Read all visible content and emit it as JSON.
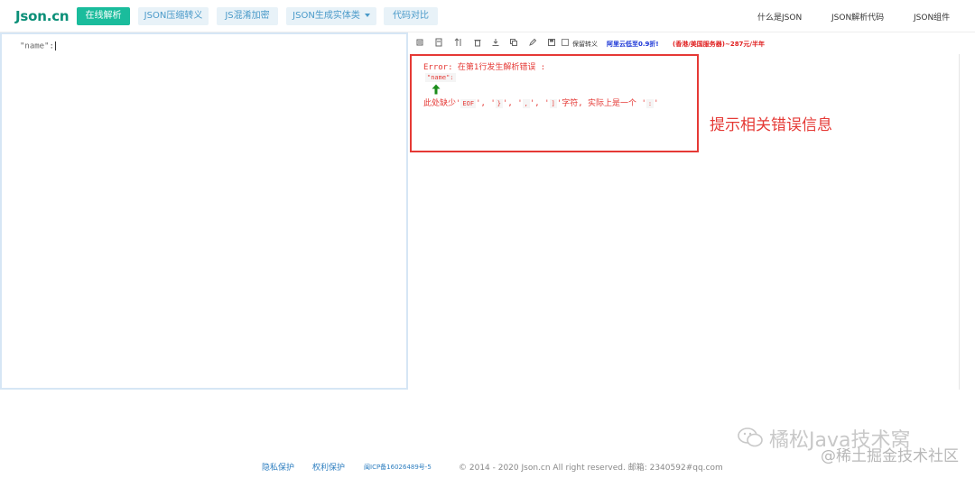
{
  "header": {
    "logo": "Json.cn",
    "nav": [
      {
        "label": "在线解析",
        "active": true
      },
      {
        "label": "JSON压缩转义",
        "active": false
      },
      {
        "label": "JS混淆加密",
        "active": false
      },
      {
        "label": "JSON生成实体类",
        "active": false,
        "dropdown": true
      },
      {
        "label": "代码对比",
        "active": false
      }
    ],
    "right_links": [
      "什么是JSON",
      "JSON解析代码",
      "JSON组件"
    ]
  },
  "editor": {
    "content": "\"name\":"
  },
  "toolbar": {
    "icons": [
      "list-icon",
      "document-icon",
      "sort-icon",
      "delete-icon",
      "download-icon",
      "copy-icon",
      "edit-icon",
      "save-icon"
    ],
    "checkbox_label": "保留转义",
    "ad_blue": "阿里云低至0.9折!",
    "ad_red": "(香港/美国服务器)~287元/半年"
  },
  "error": {
    "title": "Error: 在第1行发生解析错误 :",
    "snippet": "\"name\":",
    "message_prefix": "此处缺少'",
    "tokens": [
      "EOF",
      "}",
      ",",
      "]"
    ],
    "sep_after_0": "', '",
    "sep_after_1": "', '",
    "sep_after_2": "', '",
    "message_mid": "'字符, 实际上是一个 '",
    "actual_token": ":",
    "message_end": "'"
  },
  "annotation": "提示相关错误信息",
  "footer": {
    "privacy": "隐私保护",
    "rights": "权利保护",
    "icp": "闽ICP备16026489号-5",
    "copyright": "© 2014 - 2020 Json.cn All right reserved. 邮箱: 2340592#qq.com"
  },
  "watermark": {
    "main": "橘松Java技术窝",
    "sub": "@稀土掘金技术社区"
  },
  "colors": {
    "brand": "#0b8f78",
    "active_nav": "#1abc9c",
    "error_red": "#e53935"
  }
}
